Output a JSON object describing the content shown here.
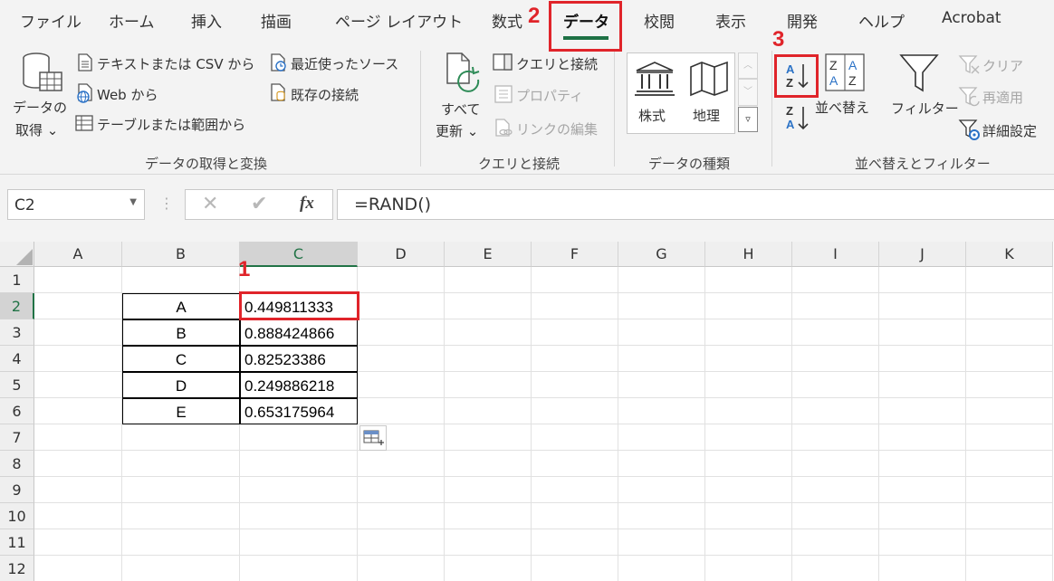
{
  "tabs": [
    "ファイル",
    "ホーム",
    "挿入",
    "描画",
    "ページ レイアウト",
    "数式",
    "データ",
    "校閲",
    "表示",
    "開発",
    "ヘルプ",
    "Acrobat"
  ],
  "active_tab": "データ",
  "ribbon": {
    "get_data": {
      "big_button": [
        "データの",
        "取得 ⌄"
      ],
      "items": [
        "テキストまたは CSV から",
        "Web から",
        "テーブルまたは範囲から",
        "最近使ったソース",
        "既存の接続"
      ],
      "label": "データの取得と変換"
    },
    "queries": {
      "refresh_button": [
        "すべて",
        "更新 ⌄"
      ],
      "items": [
        "クエリと接続",
        "プロパティ",
        "リンクの編集"
      ],
      "label": "クエリと接続"
    },
    "data_types": {
      "items": [
        "株式",
        "地理"
      ],
      "label": "データの種類"
    },
    "sort_filter": {
      "sort_label": "並べ替え",
      "filter_label": "フィルター",
      "clear_label": "クリア",
      "reapply_label": "再適用",
      "advanced_label": "詳細設定",
      "label": "並べ替えとフィルター"
    }
  },
  "formula_bar": {
    "name_box": "C2",
    "fx_label": "fx",
    "formula": "=RAND()"
  },
  "grid": {
    "columns": [
      "A",
      "B",
      "C",
      "D",
      "E",
      "F",
      "G",
      "H",
      "I",
      "J",
      "K"
    ],
    "rows": [
      "1",
      "2",
      "3",
      "4",
      "5",
      "6",
      "7",
      "8",
      "9",
      "10",
      "11",
      "12"
    ],
    "selected_cell": "C2",
    "table": [
      {
        "label": "A",
        "value": "0.449811333"
      },
      {
        "label": "B",
        "value": "0.888424866"
      },
      {
        "label": "C",
        "value": "0.82523386"
      },
      {
        "label": "D",
        "value": "0.249886218"
      },
      {
        "label": "E",
        "value": "0.653175964"
      }
    ]
  },
  "annotations": {
    "step1": "1",
    "step2": "2",
    "step3": "3"
  },
  "colors": {
    "accent": "#217346",
    "annotation": "#e0242a"
  }
}
